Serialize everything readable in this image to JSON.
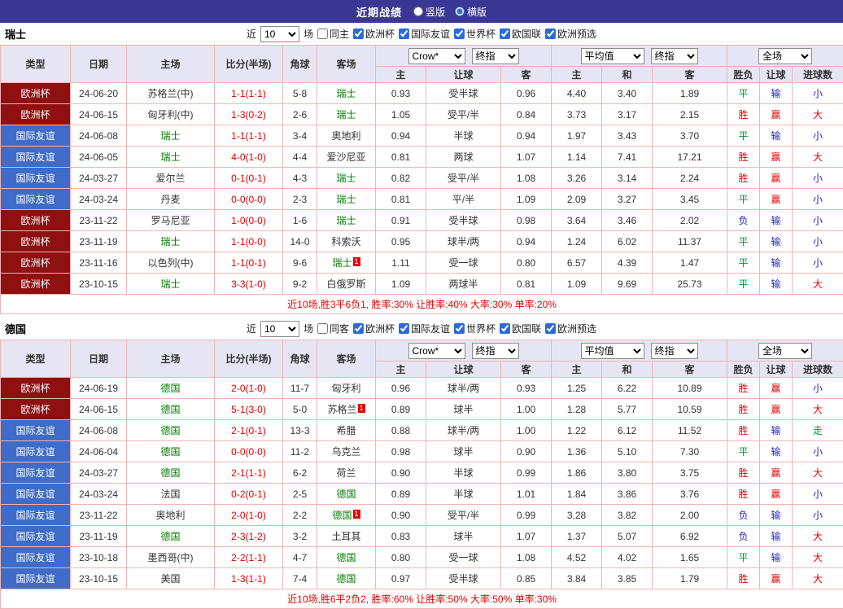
{
  "colors": {
    "topbar_purple": "#3b3794",
    "euro_badge_red": "#8e1010",
    "friendly_badge_blue": "#3e6cc8",
    "win_red": "#e60000",
    "draw_green": "#009933",
    "lose_blue": "#2424cc",
    "focus_team_green": "#008000",
    "grid_pink": "#f0b4b4",
    "header_lavender": "#e6e5f3"
  },
  "top_bar": {
    "title": "近期战绩",
    "layout_options": [
      {
        "label": "竖版",
        "selected": false
      },
      {
        "label": "横版",
        "selected": true
      }
    ]
  },
  "filter": {
    "prefix": "近",
    "count": "10",
    "suffix": "场",
    "competitions": [
      "欧洲杯",
      "国际友谊",
      "世界杯",
      "欧国联",
      "欧洲预选"
    ]
  },
  "table_header": {
    "type": "类型",
    "date": "日期",
    "home": "主场",
    "score": "比分(半场)",
    "corner": "角球",
    "away": "客场",
    "asian_source": "Crow*",
    "asian_time": "终指",
    "euro_source": "平均值",
    "euro_time": "终指",
    "scope": "全场",
    "sub_headers": [
      "主",
      "让球",
      "客",
      "主",
      "和",
      "客",
      "胜负",
      "让球",
      "进球数"
    ]
  },
  "sections": [
    {
      "team": "瑞士",
      "same_label": "同主",
      "summary": "近10场,胜3平6负1, 胜率:30% 让胜率:40% 大率:30% 单率:20%",
      "rows": [
        {
          "comp": "欧洲杯",
          "comp_type": "euro",
          "date": "24-06-20",
          "home": "苏格兰(中)",
          "home_focus": false,
          "home_badge": "",
          "score": "1-1(1-1)",
          "corner": "5-8",
          "away": "瑞士",
          "away_focus": true,
          "away_badge": "",
          "asian": [
            "0.93",
            "受半球",
            "0.96"
          ],
          "euro": [
            "4.40",
            "3.40",
            "1.89"
          ],
          "wdl": "平",
          "wdl_c": "green",
          "hcp": "输",
          "hcp_c": "blue",
          "goal": "小",
          "goal_c": "blue"
        },
        {
          "comp": "欧洲杯",
          "comp_type": "euro",
          "date": "24-06-15",
          "home": "匈牙利(中)",
          "home_focus": false,
          "home_badge": "",
          "score": "1-3(0-2)",
          "corner": "2-6",
          "away": "瑞士",
          "away_focus": true,
          "away_badge": "",
          "asian": [
            "1.05",
            "受平/半",
            "0.84"
          ],
          "euro": [
            "3.73",
            "3.17",
            "2.15"
          ],
          "wdl": "胜",
          "wdl_c": "red",
          "hcp": "赢",
          "hcp_c": "red",
          "goal": "大",
          "goal_c": "red"
        },
        {
          "comp": "国际友谊",
          "comp_type": "friendly",
          "date": "24-06-08",
          "home": "瑞士",
          "home_focus": true,
          "home_badge": "",
          "score": "1-1(1-1)",
          "corner": "3-4",
          "away": "奥地利",
          "away_focus": false,
          "away_badge": "",
          "asian": [
            "0.94",
            "半球",
            "0.94"
          ],
          "euro": [
            "1.97",
            "3.43",
            "3.70"
          ],
          "wdl": "平",
          "wdl_c": "green",
          "hcp": "输",
          "hcp_c": "blue",
          "goal": "小",
          "goal_c": "blue"
        },
        {
          "comp": "国际友谊",
          "comp_type": "friendly",
          "date": "24-06-05",
          "home": "瑞士",
          "home_focus": true,
          "home_badge": "",
          "score": "4-0(1-0)",
          "corner": "4-4",
          "away": "爱沙尼亚",
          "away_focus": false,
          "away_badge": "",
          "asian": [
            "0.81",
            "两球",
            "1.07"
          ],
          "euro": [
            "1.14",
            "7.41",
            "17.21"
          ],
          "wdl": "胜",
          "wdl_c": "red",
          "hcp": "赢",
          "hcp_c": "red",
          "goal": "大",
          "goal_c": "red"
        },
        {
          "comp": "国际友谊",
          "comp_type": "friendly",
          "date": "24-03-27",
          "home": "爱尔兰",
          "home_focus": false,
          "home_badge": "",
          "score": "0-1(0-1)",
          "corner": "4-3",
          "away": "瑞士",
          "away_focus": true,
          "away_badge": "",
          "asian": [
            "0.82",
            "受平/半",
            "1.08"
          ],
          "euro": [
            "3.26",
            "3.14",
            "2.24"
          ],
          "wdl": "胜",
          "wdl_c": "red",
          "hcp": "赢",
          "hcp_c": "red",
          "goal": "小",
          "goal_c": "blue"
        },
        {
          "comp": "国际友谊",
          "comp_type": "friendly",
          "date": "24-03-24",
          "home": "丹麦",
          "home_focus": false,
          "home_badge": "",
          "score": "0-0(0-0)",
          "corner": "2-3",
          "away": "瑞士",
          "away_focus": true,
          "away_badge": "",
          "asian": [
            "0.81",
            "平/半",
            "1.09"
          ],
          "euro": [
            "2.09",
            "3.27",
            "3.45"
          ],
          "wdl": "平",
          "wdl_c": "green",
          "hcp": "赢",
          "hcp_c": "red",
          "goal": "小",
          "goal_c": "blue"
        },
        {
          "comp": "欧洲杯",
          "comp_type": "euro",
          "date": "23-11-22",
          "home": "罗马尼亚",
          "home_focus": false,
          "home_badge": "",
          "score": "1-0(0-0)",
          "corner": "1-6",
          "away": "瑞士",
          "away_focus": true,
          "away_badge": "",
          "asian": [
            "0.91",
            "受半球",
            "0.98"
          ],
          "euro": [
            "3.64",
            "3.46",
            "2.02"
          ],
          "wdl": "负",
          "wdl_c": "blue",
          "hcp": "输",
          "hcp_c": "blue",
          "goal": "小",
          "goal_c": "blue"
        },
        {
          "comp": "欧洲杯",
          "comp_type": "euro",
          "date": "23-11-19",
          "home": "瑞士",
          "home_focus": true,
          "home_badge": "",
          "score": "1-1(0-0)",
          "corner": "14-0",
          "away": "科索沃",
          "away_focus": false,
          "away_badge": "",
          "asian": [
            "0.95",
            "球半/两",
            "0.94"
          ],
          "euro": [
            "1.24",
            "6.02",
            "11.37"
          ],
          "wdl": "平",
          "wdl_c": "green",
          "hcp": "输",
          "hcp_c": "blue",
          "goal": "小",
          "goal_c": "blue"
        },
        {
          "comp": "欧洲杯",
          "comp_type": "euro",
          "date": "23-11-16",
          "home": "以色列(中)",
          "home_focus": false,
          "home_badge": "",
          "score": "1-1(0-1)",
          "corner": "9-6",
          "away": "瑞士",
          "away_focus": true,
          "away_badge": "1",
          "asian": [
            "1.11",
            "受一球",
            "0.80"
          ],
          "euro": [
            "6.57",
            "4.39",
            "1.47"
          ],
          "wdl": "平",
          "wdl_c": "green",
          "hcp": "输",
          "hcp_c": "blue",
          "goal": "小",
          "goal_c": "blue"
        },
        {
          "comp": "欧洲杯",
          "comp_type": "euro",
          "date": "23-10-15",
          "home": "瑞士",
          "home_focus": true,
          "home_badge": "",
          "score": "3-3(1-0)",
          "corner": "9-2",
          "away": "白俄罗斯",
          "away_focus": false,
          "away_badge": "",
          "asian": [
            "1.09",
            "两球半",
            "0.81"
          ],
          "euro": [
            "1.09",
            "9.69",
            "25.73"
          ],
          "wdl": "平",
          "wdl_c": "green",
          "hcp": "输",
          "hcp_c": "blue",
          "goal": "大",
          "goal_c": "red"
        }
      ]
    },
    {
      "team": "德国",
      "same_label": "同客",
      "summary": "近10场,胜6平2负2, 胜率:60% 让胜率:50% 大率:50% 单率:30%",
      "rows": [
        {
          "comp": "欧洲杯",
          "comp_type": "euro",
          "date": "24-06-19",
          "home": "德国",
          "home_focus": true,
          "home_badge": "",
          "score": "2-0(1-0)",
          "corner": "11-7",
          "away": "匈牙利",
          "away_focus": false,
          "away_badge": "",
          "asian": [
            "0.96",
            "球半/两",
            "0.93"
          ],
          "euro": [
            "1.25",
            "6.22",
            "10.89"
          ],
          "wdl": "胜",
          "wdl_c": "red",
          "hcp": "赢",
          "hcp_c": "red",
          "goal": "小",
          "goal_c": "blue"
        },
        {
          "comp": "欧洲杯",
          "comp_type": "euro",
          "date": "24-06-15",
          "home": "德国",
          "home_focus": true,
          "home_badge": "",
          "score": "5-1(3-0)",
          "corner": "5-0",
          "away": "苏格兰",
          "away_focus": false,
          "away_badge": "1",
          "asian": [
            "0.89",
            "球半",
            "1.00"
          ],
          "euro": [
            "1.28",
            "5.77",
            "10.59"
          ],
          "wdl": "胜",
          "wdl_c": "red",
          "hcp": "赢",
          "hcp_c": "red",
          "goal": "大",
          "goal_c": "red"
        },
        {
          "comp": "国际友谊",
          "comp_type": "friendly",
          "date": "24-06-08",
          "home": "德国",
          "home_focus": true,
          "home_badge": "",
          "score": "2-1(0-1)",
          "corner": "13-3",
          "away": "希腊",
          "away_focus": false,
          "away_badge": "",
          "asian": [
            "0.88",
            "球半/两",
            "1.00"
          ],
          "euro": [
            "1.22",
            "6.12",
            "11.52"
          ],
          "wdl": "胜",
          "wdl_c": "red",
          "hcp": "输",
          "hcp_c": "blue",
          "goal": "走",
          "goal_c": "green"
        },
        {
          "comp": "国际友谊",
          "comp_type": "friendly",
          "date": "24-06-04",
          "home": "德国",
          "home_focus": true,
          "home_badge": "",
          "score": "0-0(0-0)",
          "corner": "11-2",
          "away": "乌克兰",
          "away_focus": false,
          "away_badge": "",
          "asian": [
            "0.98",
            "球半",
            "0.90"
          ],
          "euro": [
            "1.36",
            "5.10",
            "7.30"
          ],
          "wdl": "平",
          "wdl_c": "green",
          "hcp": "输",
          "hcp_c": "blue",
          "goal": "小",
          "goal_c": "blue"
        },
        {
          "comp": "国际友谊",
          "comp_type": "friendly",
          "date": "24-03-27",
          "home": "德国",
          "home_focus": true,
          "home_badge": "",
          "score": "2-1(1-1)",
          "corner": "6-2",
          "away": "荷兰",
          "away_focus": false,
          "away_badge": "",
          "asian": [
            "0.90",
            "半球",
            "0.99"
          ],
          "euro": [
            "1.86",
            "3.80",
            "3.75"
          ],
          "wdl": "胜",
          "wdl_c": "red",
          "hcp": "赢",
          "hcp_c": "red",
          "goal": "大",
          "goal_c": "red"
        },
        {
          "comp": "国际友谊",
          "comp_type": "friendly",
          "date": "24-03-24",
          "home": "法国",
          "home_focus": false,
          "home_badge": "",
          "score": "0-2(0-1)",
          "corner": "2-5",
          "away": "德国",
          "away_focus": true,
          "away_badge": "",
          "asian": [
            "0.89",
            "半球",
            "1.01"
          ],
          "euro": [
            "1.84",
            "3.86",
            "3.76"
          ],
          "wdl": "胜",
          "wdl_c": "red",
          "hcp": "赢",
          "hcp_c": "red",
          "goal": "小",
          "goal_c": "blue"
        },
        {
          "comp": "国际友谊",
          "comp_type": "friendly",
          "date": "23-11-22",
          "home": "奥地利",
          "home_focus": false,
          "home_badge": "",
          "score": "2-0(1-0)",
          "corner": "2-2",
          "away": "德国",
          "away_focus": true,
          "away_badge": "1",
          "asian": [
            "0.90",
            "受平/半",
            "0.99"
          ],
          "euro": [
            "3.28",
            "3.82",
            "2.00"
          ],
          "wdl": "负",
          "wdl_c": "blue",
          "hcp": "输",
          "hcp_c": "blue",
          "goal": "小",
          "goal_c": "blue"
        },
        {
          "comp": "国际友谊",
          "comp_type": "friendly",
          "date": "23-11-19",
          "home": "德国",
          "home_focus": true,
          "home_badge": "",
          "score": "2-3(1-2)",
          "corner": "3-2",
          "away": "土耳其",
          "away_focus": false,
          "away_badge": "",
          "asian": [
            "0.83",
            "球半",
            "1.07"
          ],
          "euro": [
            "1.37",
            "5.07",
            "6.92"
          ],
          "wdl": "负",
          "wdl_c": "blue",
          "hcp": "输",
          "hcp_c": "blue",
          "goal": "大",
          "goal_c": "red"
        },
        {
          "comp": "国际友谊",
          "comp_type": "friendly",
          "date": "23-10-18",
          "home": "墨西哥(中)",
          "home_focus": false,
          "home_badge": "",
          "score": "2-2(1-1)",
          "corner": "4-7",
          "away": "德国",
          "away_focus": true,
          "away_badge": "",
          "asian": [
            "0.80",
            "受一球",
            "1.08"
          ],
          "euro": [
            "4.52",
            "4.02",
            "1.65"
          ],
          "wdl": "平",
          "wdl_c": "green",
          "hcp": "输",
          "hcp_c": "blue",
          "goal": "大",
          "goal_c": "red"
        },
        {
          "comp": "国际友谊",
          "comp_type": "friendly",
          "date": "23-10-15",
          "home": "美国",
          "home_focus": false,
          "home_badge": "",
          "score": "1-3(1-1)",
          "corner": "7-4",
          "away": "德国",
          "away_focus": true,
          "away_badge": "",
          "asian": [
            "0.97",
            "受半球",
            "0.85"
          ],
          "euro": [
            "3.84",
            "3.85",
            "1.79"
          ],
          "wdl": "胜",
          "wdl_c": "red",
          "hcp": "赢",
          "hcp_c": "red",
          "goal": "大",
          "goal_c": "red"
        }
      ]
    }
  ]
}
